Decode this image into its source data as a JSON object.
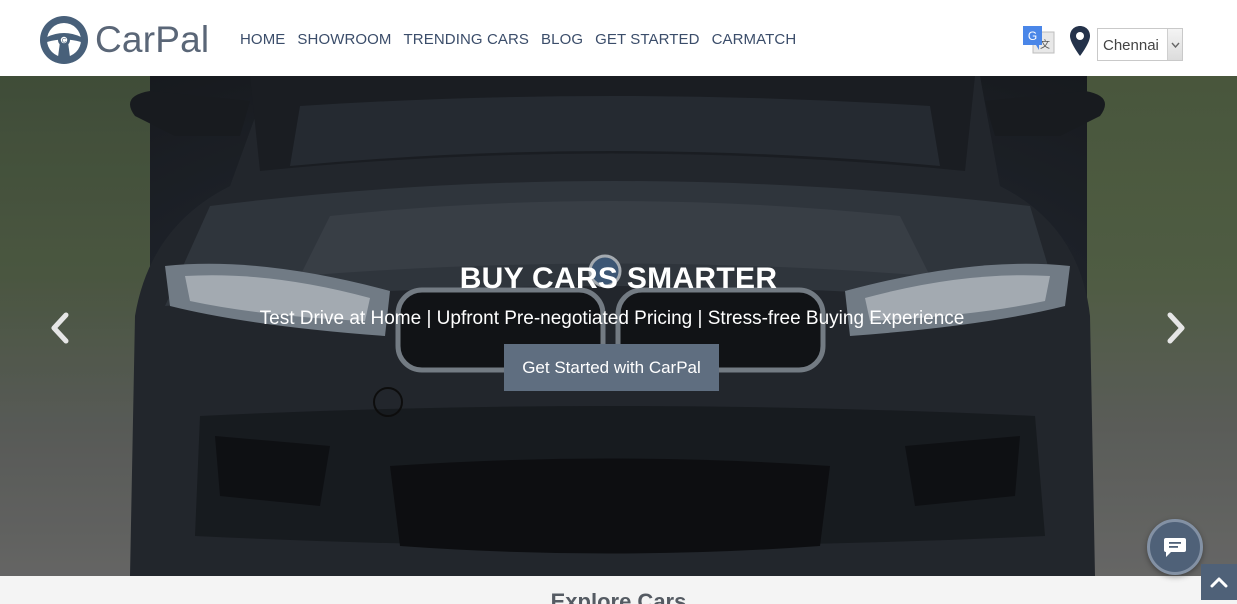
{
  "brand": {
    "name": "CarPal"
  },
  "nav": {
    "items": [
      "HOME",
      "SHOWROOM",
      "TRENDING CARS",
      "BLOG",
      "GET STARTED",
      "CARMATCH"
    ]
  },
  "location": {
    "selected_city": "Chennai"
  },
  "hero": {
    "title": "BUY CARS SMARTER",
    "subtitle": "Test Drive at Home | Upfront Pre-negotiated Pricing | Stress-free Buying Experience",
    "cta_label": "Get Started with CarPal"
  },
  "section": {
    "heading": "Explore Cars"
  },
  "icons": {
    "translate": "google-translate-icon",
    "location": "map-pin-icon",
    "prev": "chevron-left-icon",
    "next": "chevron-right-icon",
    "chat": "chat-icon",
    "scroll_top": "chevron-up-icon"
  },
  "colors": {
    "brand_text": "#5a6677",
    "nav_text": "#3b4d6a",
    "cta_bg": "#5f6e80",
    "widget_bg": "#4f6178"
  }
}
